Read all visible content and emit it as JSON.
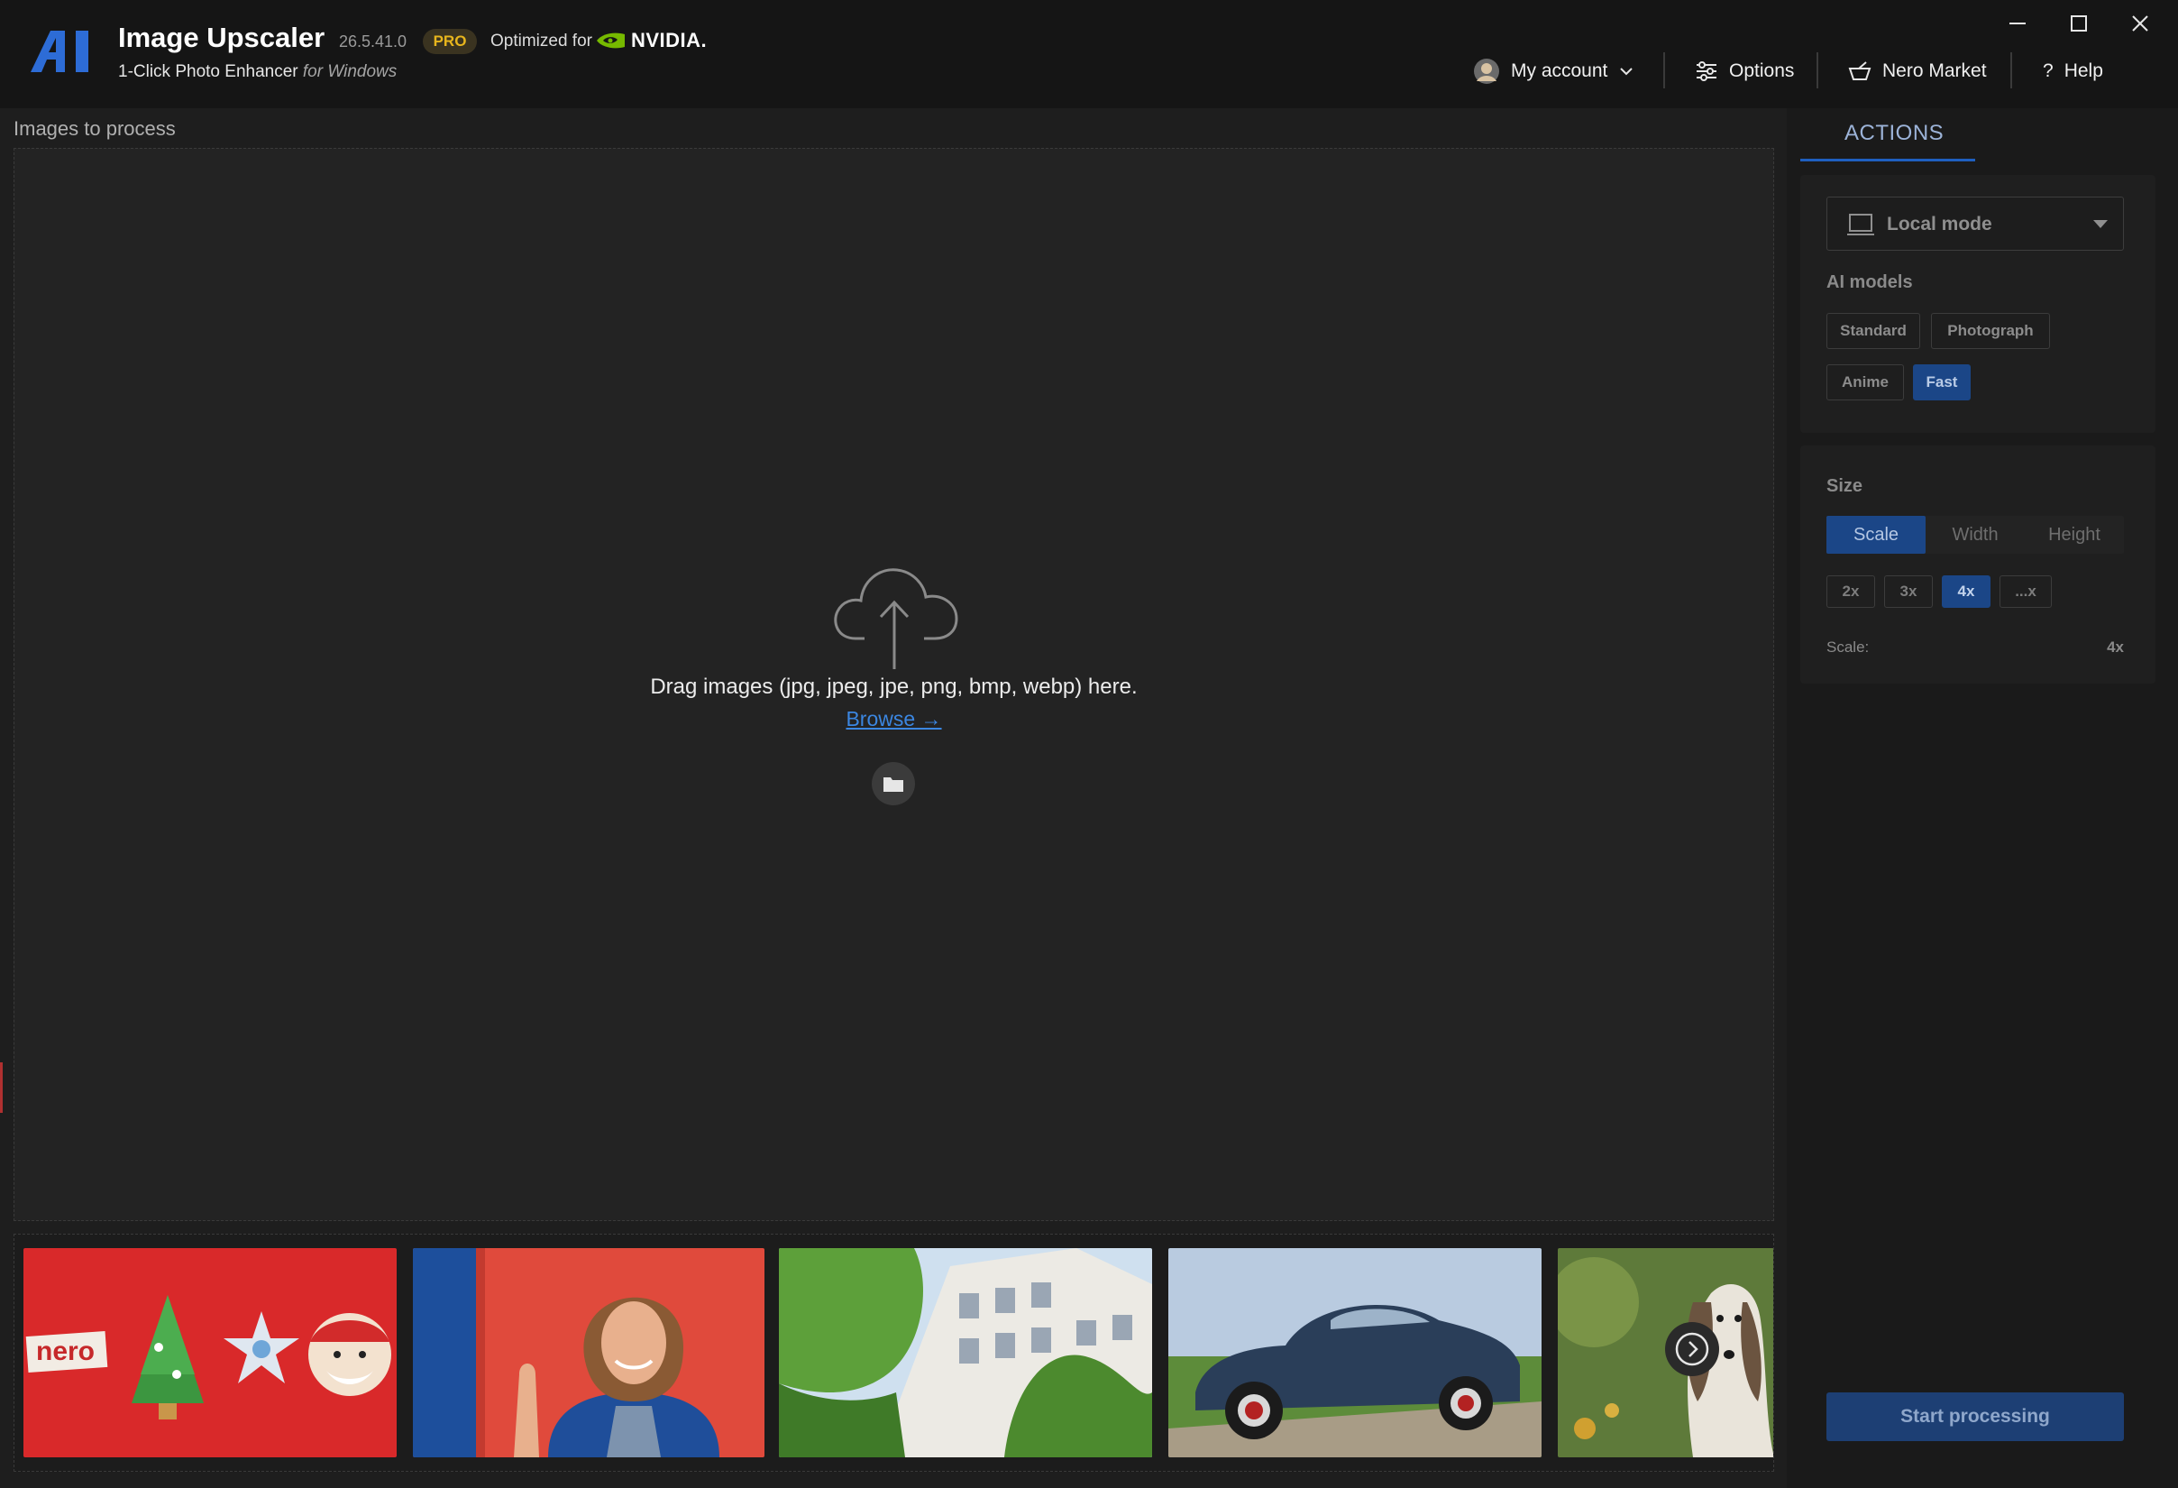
{
  "app": {
    "title": "Image Upscaler",
    "version": "26.5.41.0",
    "badge": "PRO",
    "optimized_for": "Optimized for",
    "gpu_brand": "NVIDIA.",
    "subtitle": "1-Click Photo Enhancer",
    "subtitle_platform": "for Windows",
    "logo_text": "AI"
  },
  "nav": {
    "my_account": "My account",
    "options": "Options",
    "nero_market": "Nero Market",
    "help": "Help"
  },
  "main": {
    "section_label": "Images to process",
    "drag_text": "Drag images (jpg, jpeg, jpe, png, bmp, webp) here.",
    "browse": "Browse →"
  },
  "samples": [
    {
      "name": "Christmas cookies",
      "logo_text": "nero"
    },
    {
      "name": "Smiling woman"
    },
    {
      "name": "Building with ivy"
    },
    {
      "name": "Vintage car"
    },
    {
      "name": "Dog"
    }
  ],
  "panel": {
    "tab": "ACTIONS",
    "mode": "Local mode",
    "ai_models_title": "AI models",
    "models": [
      {
        "label": "Standard",
        "active": false
      },
      {
        "label": "Photograph",
        "active": false
      },
      {
        "label": "Anime",
        "active": false
      },
      {
        "label": "Fast",
        "active": true
      }
    ],
    "size_title": "Size",
    "size_tabs": [
      {
        "label": "Scale",
        "active": true
      },
      {
        "label": "Width",
        "active": false
      },
      {
        "label": "Height",
        "active": false
      }
    ],
    "scales": [
      {
        "label": "2x",
        "active": false
      },
      {
        "label": "3x",
        "active": false
      },
      {
        "label": "4x",
        "active": true
      },
      {
        "label": "...x",
        "active": false
      }
    ],
    "scale_label": "Scale:",
    "scale_value": "4x",
    "start_button": "Start processing"
  },
  "colors": {
    "accent": "#1b4687",
    "pro_badge": "#e7b51d",
    "link": "#3b86e0",
    "nvidia_green": "#76b900"
  }
}
